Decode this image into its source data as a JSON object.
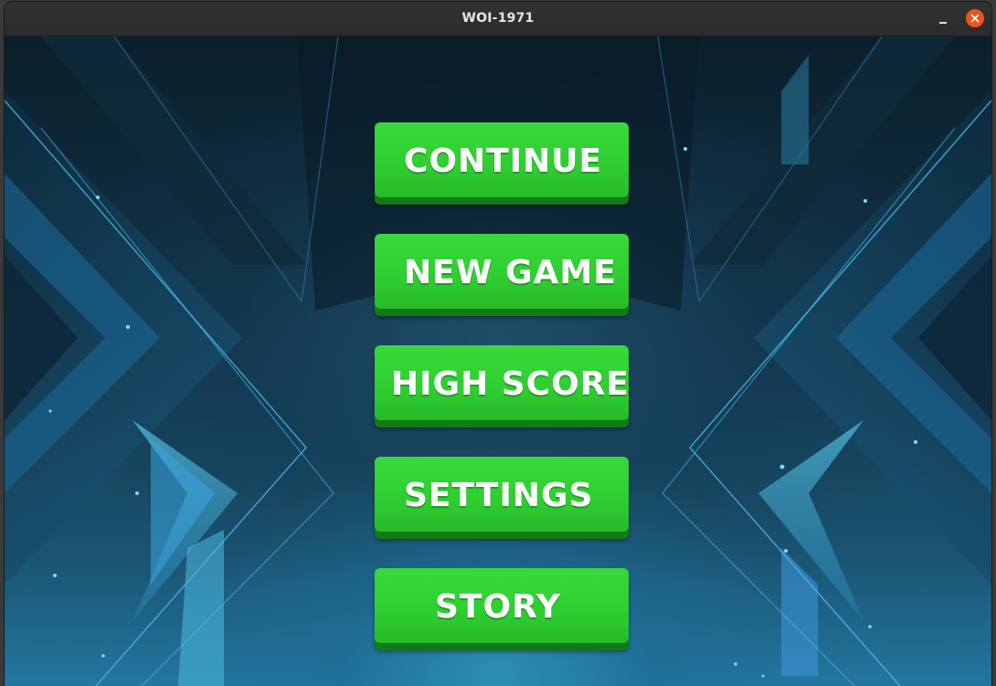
{
  "window": {
    "title": "WOI-1971",
    "minimize_symbol": "–",
    "close_icon": "close-icon",
    "close_color": "#e95420"
  },
  "menu": {
    "continue_label": "CONTINUE",
    "new_game_label": "NEW GAME",
    "high_score_label": "HIGH SCORE",
    "settings_label": "SETTINGS",
    "story_label": "STORY",
    "button_color": "#33d035",
    "button_shadow_color": "#137a15"
  },
  "background": {
    "theme": "blue-tech-chevrons",
    "primary_color": "#123246",
    "accent_color": "#3fb6e0"
  }
}
